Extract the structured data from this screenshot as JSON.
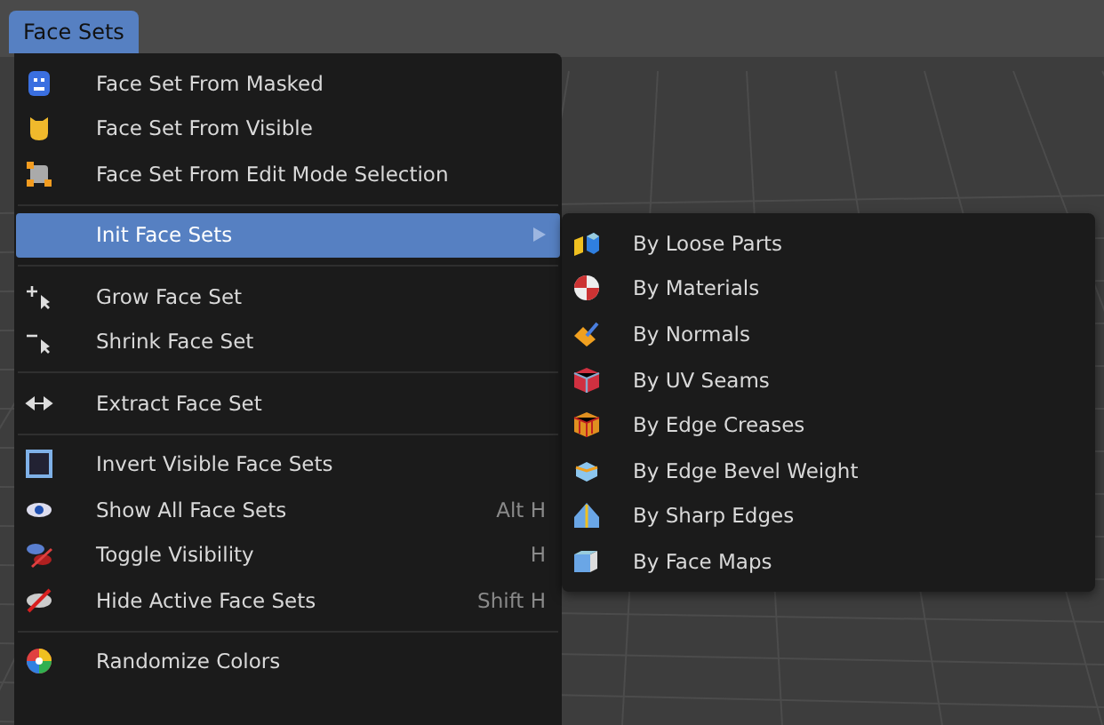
{
  "header": {
    "menu_title": "Face Sets",
    "selected": true
  },
  "menu": {
    "sections": [
      {
        "items": [
          {
            "label": "Face Set From Masked",
            "selected": false
          },
          {
            "label": "Face Set From Visible",
            "selected": false
          },
          {
            "label": "Face Set From Edit Mode Selection",
            "selected": false
          }
        ]
      },
      {
        "items": [
          {
            "label": "Init Face Sets",
            "selected": true,
            "has_submenu": true
          }
        ]
      },
      {
        "items": [
          {
            "label": "Grow Face Set",
            "selected": false
          },
          {
            "label": "Shrink Face Set",
            "selected": false
          }
        ]
      },
      {
        "items": [
          {
            "label": "Extract Face Set",
            "selected": false
          }
        ]
      },
      {
        "items": [
          {
            "label": "Invert Visible Face Sets",
            "selected": false
          },
          {
            "label": "Show All Face Sets",
            "selected": false,
            "shortcut": "Alt H"
          },
          {
            "label": "Toggle Visibility",
            "selected": false,
            "shortcut": "H"
          },
          {
            "label": "Hide Active Face Sets",
            "selected": false,
            "shortcut": "Shift H"
          }
        ]
      },
      {
        "items": [
          {
            "label": "Randomize Colors",
            "selected": false
          }
        ]
      }
    ]
  },
  "submenu": {
    "items": [
      {
        "label": "By Loose Parts",
        "selected": false
      },
      {
        "label": "By Materials",
        "selected": false
      },
      {
        "label": "By Normals",
        "selected": false
      },
      {
        "label": "By UV Seams",
        "selected": false
      },
      {
        "label": "By Edge Creases",
        "selected": false
      },
      {
        "label": "By Edge Bevel Weight",
        "selected": false
      },
      {
        "label": "By Sharp Edges",
        "selected": false
      },
      {
        "label": "By Face Maps",
        "selected": false
      }
    ]
  }
}
